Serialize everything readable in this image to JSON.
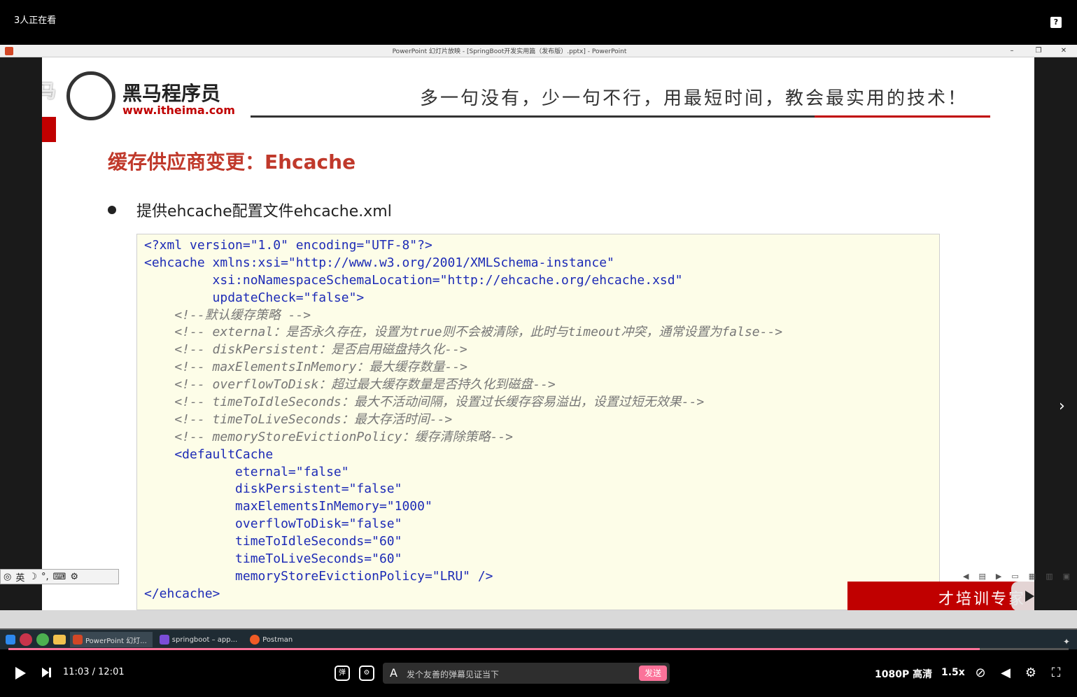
{
  "overlay": {
    "viewers": "3人正在看",
    "help": "?"
  },
  "ppt": {
    "window_title": "PowerPoint 幻灯片放映 - [SpringBoot开发实用篇（发布版）.pptx] - PowerPoint",
    "win_minimize": "–",
    "win_restore": "❐",
    "win_close": "✕",
    "slide": {
      "brand": "黑马程序员",
      "url": "www.itheima.com",
      "watermark": "黑马",
      "slogan": "多一句没有，少一句不行，用最短时间，教会最实用的技术！",
      "title": "缓存供应商变更：Ehcache",
      "bullet": "提供ehcache配置文件ehcache.xml",
      "badge_text": "才培训专家"
    },
    "ime": {
      "lang": "英",
      "moon": "☽",
      "punct": "°,",
      "keyboard": "⌨",
      "settings": "⚙"
    }
  },
  "code": {
    "l01": "<?xml version=\"1.0\" encoding=\"UTF-8\"?>",
    "l02": "<ehcache xmlns:xsi=\"http://www.w3.org/2001/XMLSchema-instance\"",
    "l03": "         xsi:noNamespaceSchemaLocation=\"http://ehcache.org/ehcache.xsd\"",
    "l04": "         updateCheck=\"false\">",
    "l05": "    <!--默认缓存策略 -->",
    "l06": "    <!-- external：是否永久存在，设置为true则不会被清除，此时与timeout冲突，通常设置为false-->",
    "l07": "    <!-- diskPersistent：是否启用磁盘持久化-->",
    "l08": "    <!-- maxElementsInMemory：最大缓存数量-->",
    "l09": "    <!-- overflowToDisk：超过最大缓存数量是否持久化到磁盘-->",
    "l10": "    <!-- timeToIdleSeconds：最大不活动间隔，设置过长缓存容易溢出，设置过短无效果-->",
    "l11": "    <!-- timeToLiveSeconds：最大存活时间-->",
    "l12": "    <!-- memoryStoreEvictionPolicy：缓存清除策略-->",
    "l13": "    <defaultCache",
    "l14": "            eternal=\"false\"",
    "l15": "            diskPersistent=\"false\"",
    "l16": "            maxElementsInMemory=\"1000\"",
    "l17": "            overflowToDisk=\"false\"",
    "l18": "            timeToIdleSeconds=\"60\"",
    "l19": "            timeToLiveSeconds=\"60\"",
    "l20": "            memoryStoreEvictionPolicy=\"LRU\" />",
    "l21": "</ehcache>"
  },
  "taskbar": {
    "apps": [
      {
        "label": "PowerPoint 幻灯...",
        "color": "#d24726"
      },
      {
        "label": "springboot – app...",
        "color": "#7b4dd6"
      },
      {
        "label": "Postman",
        "color": "#ef5b25"
      }
    ]
  },
  "player": {
    "progress": 0.916,
    "current_time": "11:03",
    "separator": "/",
    "duration": "12:01",
    "danmaku_placeholder": "发个友善的弹幕见证当下",
    "send_label": "发送",
    "quality": "1080P 高清",
    "speed": "1.5x"
  },
  "colors": {
    "accent": "#fb7299",
    "slide_red": "#c00000",
    "code_bg": "#fdfde8"
  }
}
